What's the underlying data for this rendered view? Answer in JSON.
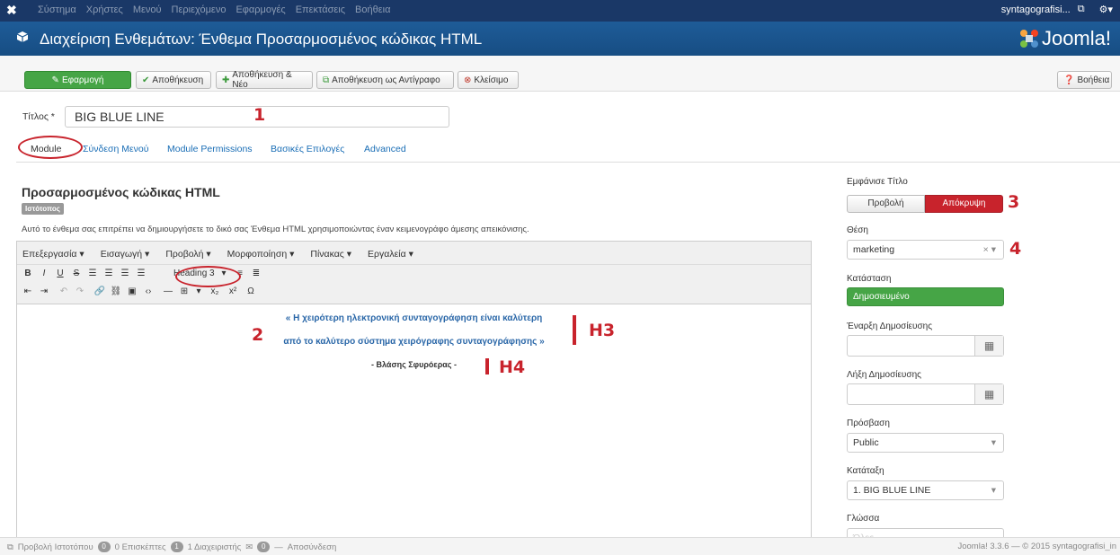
{
  "topbar": {
    "logo": "✖",
    "menu": [
      "Σύστημα",
      "Χρήστες",
      "Μενού",
      "Περιεχόμενο",
      "Εφαρμογές",
      "Επεκτάσεις",
      "Βοήθεια"
    ],
    "user": "syntagografisi...",
    "ext_icon": "⧉",
    "gear": "⚙▾"
  },
  "header": {
    "title": "Διαχείριση Ενθεμάτων: Ένθεμα Προσαρμοσμένος κώδικας HTML",
    "logo_text": "Joomla!"
  },
  "toolbar": {
    "apply": "Εφαρμογή",
    "save": "Αποθήκευση",
    "save_new": "Αποθήκευση & Νέο",
    "save_copy": "Αποθήκευση ως Αντίγραφο",
    "close": "Κλείσιμο",
    "help": "Βοήθεια"
  },
  "form": {
    "title_label": "Τίτλος *",
    "title_value": "BIG BLUE LINE"
  },
  "tabs": [
    "Module",
    "Σύνδεση Μενού",
    "Module Permissions",
    "Βασικές Επιλογές",
    "Advanced"
  ],
  "module": {
    "heading": "Προσαρμοσμένος κώδικας HTML",
    "badge": "Ιστότοπος",
    "description": "Αυτό το ένθεμα σας επιτρέπει να δημιουργήσετε το δικό σας Ένθεμα HTML χρησιμοποιώντας έναν κειμενογράφο άμεσης απεικόνισης."
  },
  "editor": {
    "menus": [
      "Επεξεργασία ▾",
      "Εισαγωγή ▾",
      "Προβολή ▾",
      "Μορφοποίηση ▾",
      "Πίνακας ▾",
      "Εργαλεία ▾"
    ],
    "format_select": "Heading 3",
    "quote_line1": "« Η χειρότερη ηλεκτρονική συνταγογράφηση είναι καλύτερη",
    "quote_line2": "από το καλύτερο σύστημα χειρόγραφης συνταγογράφησης »",
    "author": "- Βλάσης Σφυρόερας -"
  },
  "annotations": {
    "n1": "1",
    "n2": "2",
    "n3": "3",
    "n4": "4",
    "h3": "H3",
    "h4": "H4"
  },
  "right_panel": {
    "show_title_label": "Εμφάνισε Τίτλο",
    "show_btn": "Προβολή",
    "hide_btn": "Απόκρυψη",
    "position_label": "Θέση",
    "position_value": "marketing",
    "status_label": "Κατάσταση",
    "status_value": "Δημοσιευμένο",
    "publish_start_label": "Έναρξη Δημοσίευσης",
    "publish_end_label": "Λήξη Δημοσίευσης",
    "access_label": "Πρόσβαση",
    "access_value": "Public",
    "ordering_label": "Κατάταξη",
    "ordering_value": "1. BIG BLUE LINE",
    "language_label": "Γλώσσα",
    "language_value": "Όλες"
  },
  "footer": {
    "view_site": "Προβολή Ιστοτόπου",
    "visitors_count": "0",
    "visitors": "0 Επισκέπτες",
    "admins_count": "1",
    "admins": "1 Διαχειριστής",
    "messages_count": "0",
    "logout": "Αποσύνδεση",
    "version": "Joomla! 3.3.6 — © 2015 syntagografisi_in"
  },
  "colors": {
    "topbar": "#1a3867",
    "header": "#1b568f",
    "green": "#46a546",
    "red": "#c8232c",
    "link": "#1a6eb6"
  }
}
